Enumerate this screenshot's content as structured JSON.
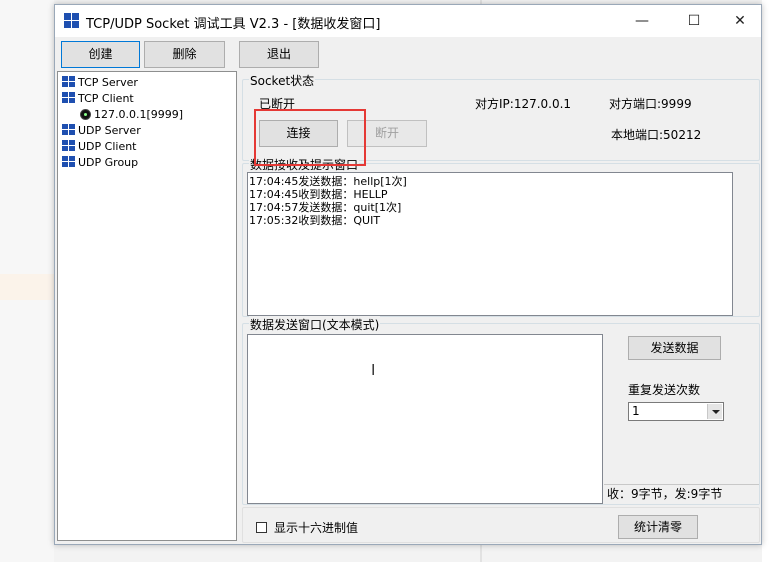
{
  "colors": {
    "accent": "#0078d7",
    "icon_blue": "#1e4fb0",
    "highlight": "#e53935"
  },
  "window": {
    "title": "TCP/UDP Socket 调试工具 V2.3 - [数据收发窗口]",
    "minimize": "—",
    "maximize": "☐",
    "close": "✕"
  },
  "toolbar": {
    "create": "创建",
    "delete": "删除",
    "exit": "退出"
  },
  "tree": {
    "items": [
      {
        "label": "TCP Server",
        "icon": "network-icon"
      },
      {
        "label": "TCP Client",
        "icon": "network-icon"
      },
      {
        "label": "127.0.0.1[9999]",
        "icon": "connection-dot-icon"
      },
      {
        "label": "UDP Server",
        "icon": "network-icon"
      },
      {
        "label": "UDP Client",
        "icon": "network-icon"
      },
      {
        "label": "UDP Group",
        "icon": "network-icon"
      }
    ]
  },
  "socket": {
    "group_title": "Socket状态",
    "status": "已断开",
    "remote_ip": "对方IP:127.0.0.1",
    "remote_port": "对方端口:9999",
    "local_port": "本地端口:50212",
    "connect": "连接",
    "disconnect": "断开"
  },
  "receive": {
    "group_title": "数据接收及提示窗口",
    "lines": [
      "17:04:45发送数据：hellp[1次]",
      "17:04:45收到数据：HELLP",
      "17:04:57发送数据：quit[1次]",
      "17:05:32收到数据：QUIT"
    ]
  },
  "send": {
    "group_title": "数据发送窗口(文本模式)",
    "send_button": "发送数据",
    "repeat_label": "重复发送次数",
    "repeat_value": "1",
    "stats": "收：9字节，发:9字节",
    "input_value": ""
  },
  "footer": {
    "hex_label": "显示十六进制值",
    "hex_checked": false,
    "reset_stats": "统计清零"
  }
}
